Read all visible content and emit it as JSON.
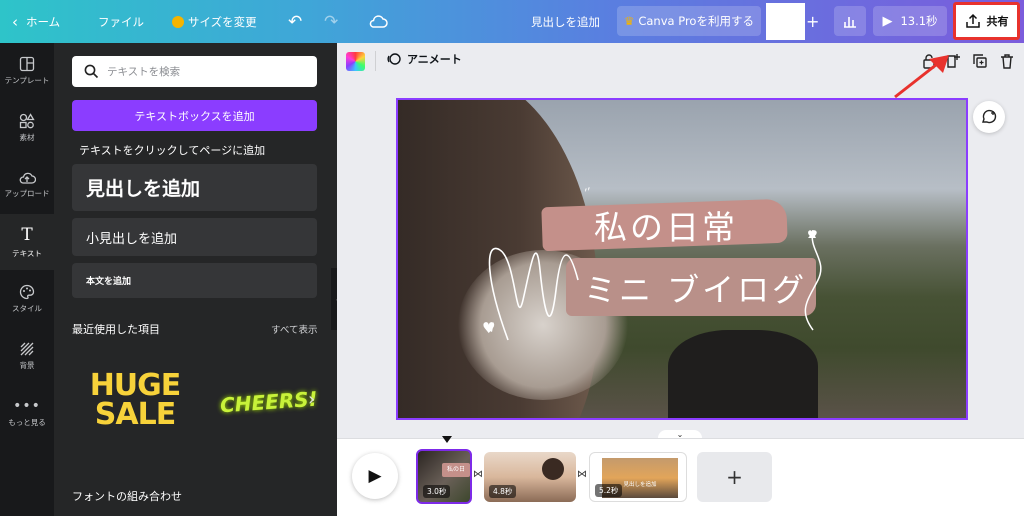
{
  "topbar": {
    "home": "ホーム",
    "file": "ファイル",
    "resize": "サイズを変更",
    "heading_add": "見出しを追加",
    "canva_pro": "Canva Proを利用する",
    "play_time": "13.1秒",
    "share": "共有"
  },
  "rail": [
    {
      "label": "テンプレート",
      "icon": "template-icon"
    },
    {
      "label": "素材",
      "icon": "elements-icon"
    },
    {
      "label": "アップロード",
      "icon": "upload-icon"
    },
    {
      "label": "テキスト",
      "icon": "text-icon"
    },
    {
      "label": "スタイル",
      "icon": "palette-icon"
    },
    {
      "label": "背景",
      "icon": "background-icon"
    },
    {
      "label": "もっと見る",
      "icon": "more-icon"
    }
  ],
  "panel": {
    "search_placeholder": "テキストを検索",
    "add_textbox": "テキストボックスを追加",
    "click_hint": "テキストをクリックしてページに追加",
    "add_heading": "見出しを追加",
    "add_subheading": "小見出しを追加",
    "add_body": "本文を追加",
    "recent": "最近使用した項目",
    "show_all": "すべて表示",
    "huge": "HUGE",
    "sale": "SALE",
    "cheers": "CHEERS!",
    "font_combos": "フォントの組み合わせ"
  },
  "canvas_toolbar": {
    "animate": "アニメート"
  },
  "design": {
    "line1": "私の日常",
    "line2": "ミニ ブイログ"
  },
  "timeline": {
    "pages": [
      {
        "duration": "3.0秒",
        "thumb_text": "私の日"
      },
      {
        "duration": "4.8秒"
      },
      {
        "duration": "5.2秒",
        "thumb_text": "見出しを追加"
      }
    ]
  },
  "colors": {
    "accent": "#7d2ae8",
    "highlight": "#e8322d"
  }
}
